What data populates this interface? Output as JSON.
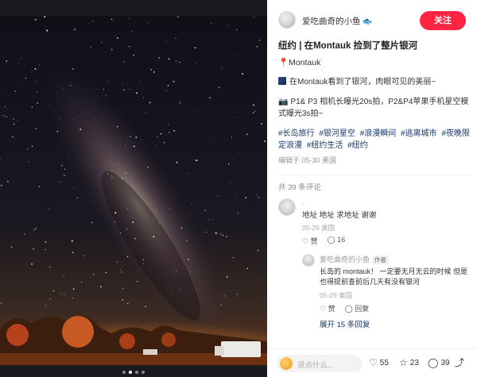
{
  "author": {
    "name": "爱吃曲奇的小鱼",
    "badge_icon": "fish-icon"
  },
  "follow_label": "关注",
  "post": {
    "title": "纽约 | 在Montauk 捡到了整片银河",
    "location": "Montauk",
    "paragraph1": "在Montauk看到了银河，肉眼可见的美丽~",
    "paragraph2": "P1& P3  相机长曝光20s拍，P2&P4苹果手机星空模式曝光3s拍~",
    "tags": [
      "#长岛旅行",
      "#银河星空",
      "#浪漫瞬间",
      "#逃离城市",
      "#夜晚限定浪漫",
      "#纽约生活",
      "#纽约"
    ],
    "edited": "编辑于 05-30 美国"
  },
  "comments": {
    "count_label": "共 39 条评论",
    "first": {
      "name": ".",
      "text": "地址 地址 求地址 谢谢",
      "date": "05-29 美国",
      "like_label": "赞",
      "reply_count": "16"
    },
    "reply": {
      "name": "爱吃曲奇的小鱼",
      "badge": "作者",
      "text": "长岛的 montauk！ 一定要无月无云的时候 但是也得提前查前后几天有没有银河",
      "date": "05-29 美国",
      "like_label": "赞",
      "reply_label": "回复"
    },
    "expand_label": "展开 15 条回复"
  },
  "footer": {
    "placeholder": "说点什么...",
    "likes": "55",
    "stars": "23",
    "comments": "39"
  }
}
